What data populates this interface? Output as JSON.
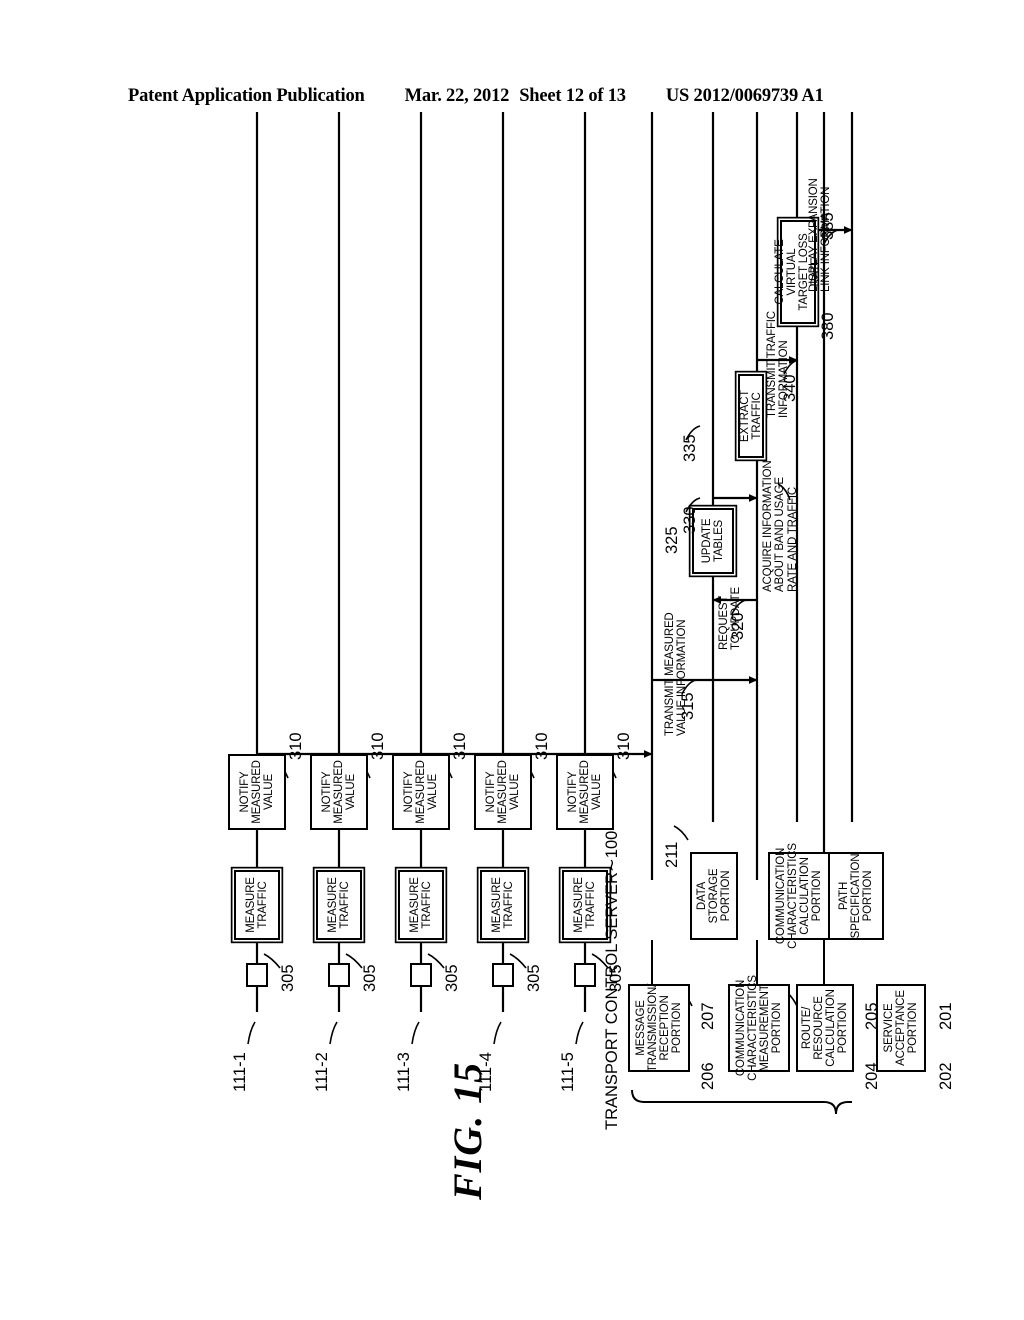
{
  "header": {
    "publication": "Patent Application Publication",
    "date": "Mar. 22, 2012",
    "sheet": "Sheet 12 of 13",
    "patent_number": "US 2012/0069739 A1"
  },
  "figure": {
    "title": "FIG. 15",
    "server_group_label": "TRANSPORT CONTROL SERVER",
    "server_group_ref": "100"
  },
  "server_components": [
    {
      "ref": "202",
      "label": "SERVICE\nACCEPTANCE\nPORTION"
    },
    {
      "ref": "201",
      "label": "PATH\nSPECIFICATION\nPORTION"
    },
    {
      "ref": "204",
      "label": "ROUTE/\nRESOURCE\nCALCULATION\nPORTION"
    },
    {
      "ref": "205",
      "label": "COMMUNICATION\nCHARACTERISTICS\nCALCULATION\nPORTION"
    },
    {
      "ref": "206",
      "label": "COMMUNICATION\nCHARACTERISTICS\nMEASUREMENT\nPORTION"
    },
    {
      "ref": "207",
      "label": "MESSAGE\nTRANSMISSION/\nRECEPTION\nPORTION"
    },
    {
      "ref": "211",
      "label": "DATA\nSTORAGE\nPORTION"
    }
  ],
  "nodes": [
    {
      "id": "111-1",
      "measure_ref": "305",
      "measure_label": "MEASURE\nTRAFFIC",
      "notify_ref": "310",
      "notify_label": "NOTIFY\nMEASURED\nVALUE"
    },
    {
      "id": "111-2",
      "measure_ref": "305",
      "measure_label": "MEASURE\nTRAFFIC",
      "notify_ref": "310",
      "notify_label": "NOTIFY\nMEASURED\nVALUE"
    },
    {
      "id": "111-3",
      "measure_ref": "305",
      "measure_label": "MEASURE\nTRAFFIC",
      "notify_ref": "310",
      "notify_label": "NOTIFY\nMEASURED\nVALUE"
    },
    {
      "id": "111-4",
      "measure_ref": "305",
      "measure_label": "MEASURE\nTRAFFIC",
      "notify_ref": "310",
      "notify_label": "NOTIFY\nMEASURED\nVALUE"
    },
    {
      "id": "111-5",
      "measure_ref": "305",
      "measure_label": "MEASURE\nTRAFFIC",
      "notify_ref": "310",
      "notify_label": "NOTIFY\nMEASURED\nVALUE"
    }
  ],
  "messages": [
    {
      "ref": "315",
      "label": "TRANSMIT MEASURED\nVALUE INFORMATION"
    },
    {
      "ref": "320",
      "label": "REQUEST\nTO UPDATE"
    },
    {
      "ref": "330",
      "label": "ACQUIRE INFORMATION\nABOUT BAND USAGE\nRATE AND TRAFFIC"
    },
    {
      "ref": "340",
      "label": "TRANSMIT TRAFFIC\nINFORMATION"
    },
    {
      "ref": "385",
      "label": "DISPLAY EXPANSION\nLINK INFORMATION"
    }
  ],
  "actions": [
    {
      "ref": "325",
      "label": "UPDATE\nTABLES"
    },
    {
      "ref": "335",
      "label": "EXTRACT TRAFFIC"
    },
    {
      "ref": "380",
      "label": "CALCULATE VIRTUAL\nTARGET LOSS RATE"
    }
  ],
  "colors": {
    "ink": "#000000",
    "paper": "#ffffff"
  }
}
